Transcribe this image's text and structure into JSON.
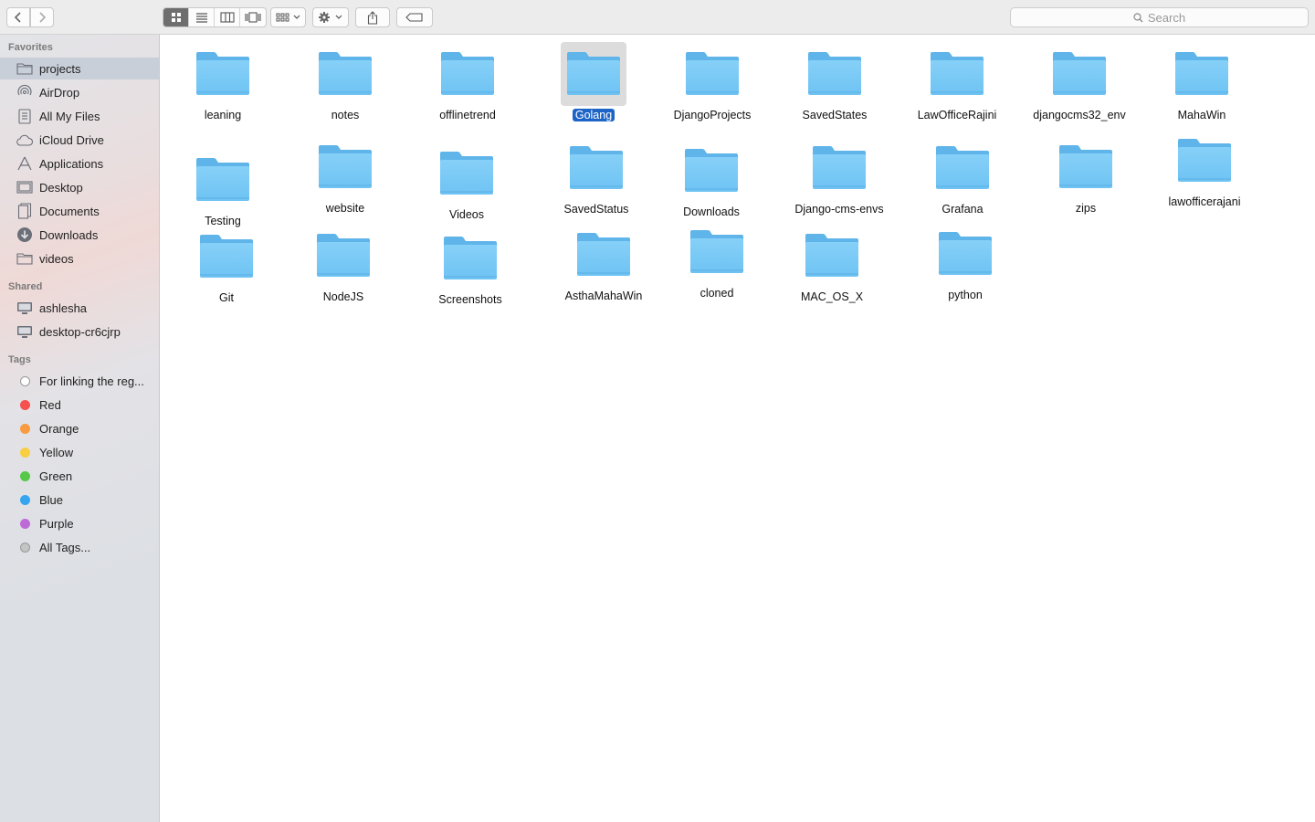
{
  "toolbar": {
    "search_placeholder": "Search",
    "view_modes": [
      "icon-view",
      "list-view",
      "column-view",
      "cover-flow-view"
    ],
    "active_view": "icon-view"
  },
  "sidebar": {
    "favorites_title": "Favorites",
    "favorites": [
      {
        "label": "projects",
        "icon": "folder-icon",
        "selected": true
      },
      {
        "label": "AirDrop",
        "icon": "airdrop-icon"
      },
      {
        "label": "All My Files",
        "icon": "all-files-icon"
      },
      {
        "label": "iCloud Drive",
        "icon": "cloud-icon"
      },
      {
        "label": "Applications",
        "icon": "applications-icon"
      },
      {
        "label": "Desktop",
        "icon": "desktop-icon"
      },
      {
        "label": "Documents",
        "icon": "documents-icon"
      },
      {
        "label": "Downloads",
        "icon": "downloads-icon"
      },
      {
        "label": "videos",
        "icon": "folder-icon"
      }
    ],
    "shared_title": "Shared",
    "shared": [
      {
        "label": "ashlesha",
        "icon": "computer-icon"
      },
      {
        "label": "desktop-cr6cjrp",
        "icon": "computer-icon"
      }
    ],
    "tags_title": "Tags",
    "tags": [
      {
        "label": "For linking the reg...",
        "color": "#ffffff"
      },
      {
        "label": "Red",
        "color": "#f5514f"
      },
      {
        "label": "Orange",
        "color": "#f89c3f"
      },
      {
        "label": "Yellow",
        "color": "#f8cf43"
      },
      {
        "label": "Green",
        "color": "#55c846"
      },
      {
        "label": "Blue",
        "color": "#36a5f0"
      },
      {
        "label": "Purple",
        "color": "#bd6ad6"
      },
      {
        "label": "All Tags...",
        "color": "#c4c4c4"
      }
    ]
  },
  "folders": [
    {
      "name": "leaning"
    },
    {
      "name": "notes"
    },
    {
      "name": "offlinetrend"
    },
    {
      "name": "Golang",
      "selected": true
    },
    {
      "name": "DjangoProjects"
    },
    {
      "name": "SavedStates"
    },
    {
      "name": "LawOfficeRajini"
    },
    {
      "name": "djangocms32_env"
    },
    {
      "name": "MahaWin"
    },
    {
      "name": "Testing"
    },
    {
      "name": "website"
    },
    {
      "name": "Videos"
    },
    {
      "name": "SavedStatus"
    },
    {
      "name": "Downloads"
    },
    {
      "name": "Django-cms-envs"
    },
    {
      "name": "Grafana"
    },
    {
      "name": "zips"
    },
    {
      "name": "lawofficerajani"
    },
    {
      "name": "Git"
    },
    {
      "name": "NodeJS"
    },
    {
      "name": "Screenshots"
    },
    {
      "name": "AsthaMahaWin"
    },
    {
      "name": "cloned"
    },
    {
      "name": "MAC_OS_X"
    },
    {
      "name": "python"
    }
  ]
}
